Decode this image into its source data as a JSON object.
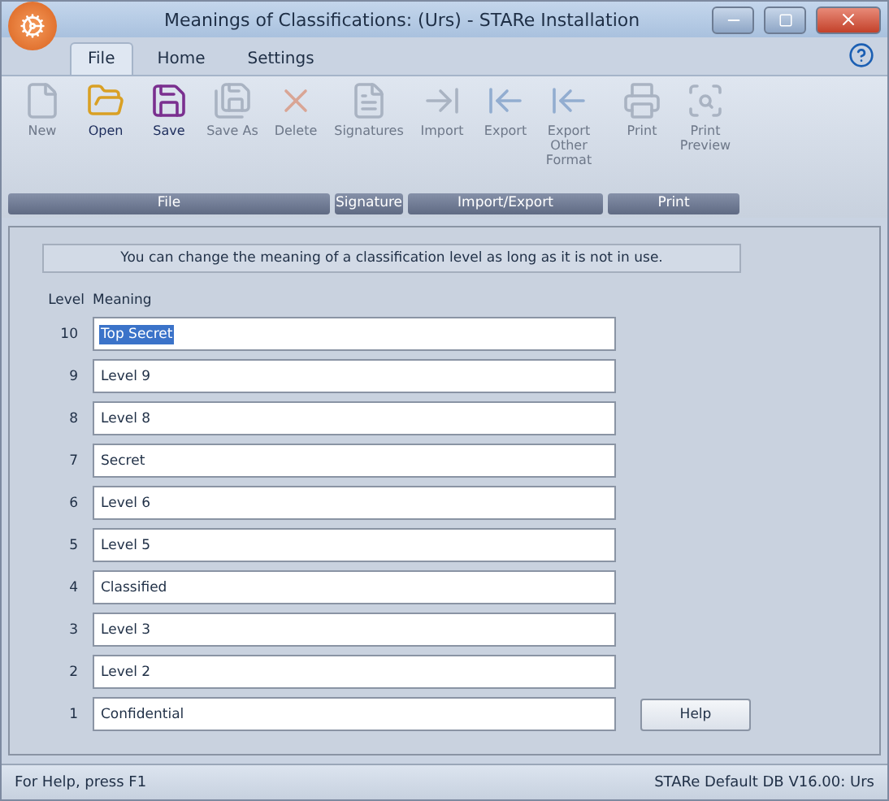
{
  "window": {
    "title": "Meanings of Classifications: (Urs) - STARe Installation"
  },
  "ribbon_tabs": [
    {
      "label": "File",
      "selected": true
    },
    {
      "label": "Home",
      "selected": false
    },
    {
      "label": "Settings",
      "selected": false
    }
  ],
  "ribbon_groups": [
    {
      "label": "File",
      "buttons": [
        {
          "label": "New",
          "kind": "new",
          "disabled": true
        },
        {
          "label": "Open",
          "kind": "open",
          "disabled": false
        },
        {
          "label": "Save",
          "kind": "save",
          "disabled": false
        },
        {
          "label": "Save As",
          "kind": "saveas",
          "disabled": true
        },
        {
          "label": "Delete",
          "kind": "delete",
          "disabled": true
        }
      ]
    },
    {
      "label": "Signature",
      "buttons": [
        {
          "label": "Signatures",
          "kind": "document",
          "disabled": true
        }
      ]
    },
    {
      "label": "Import/Export",
      "buttons": [
        {
          "label": "Import",
          "kind": "import",
          "disabled": true
        },
        {
          "label": "Export",
          "kind": "export",
          "disabled": true
        },
        {
          "label": "Export Other Format",
          "kind": "export",
          "disabled": true
        }
      ]
    },
    {
      "label": "Print",
      "buttons": [
        {
          "label": "Print",
          "kind": "print",
          "disabled": true
        },
        {
          "label": "Print Preview",
          "kind": "preview",
          "disabled": true
        }
      ]
    }
  ],
  "info_message": "You can change the meaning of a classification level as long as it is not in use.",
  "columns": [
    "Level",
    "Meaning"
  ],
  "rows": [
    {
      "level": "10",
      "meaning": "Top Secret",
      "selected": true
    },
    {
      "level": "9",
      "meaning": "Level 9",
      "selected": false
    },
    {
      "level": "8",
      "meaning": "Level 8",
      "selected": false
    },
    {
      "level": "7",
      "meaning": "Secret",
      "selected": false
    },
    {
      "level": "6",
      "meaning": "Level 6",
      "selected": false
    },
    {
      "level": "5",
      "meaning": "Level 5",
      "selected": false
    },
    {
      "level": "4",
      "meaning": "Classified",
      "selected": false
    },
    {
      "level": "3",
      "meaning": "Level 3",
      "selected": false
    },
    {
      "level": "2",
      "meaning": "Level 2",
      "selected": false
    },
    {
      "level": "1",
      "meaning": "Confidential",
      "selected": false
    }
  ],
  "help_button": "Help",
  "status_bar": {
    "left": "For Help, press F1",
    "right": "STARe Default DB V16.00: Urs"
  }
}
